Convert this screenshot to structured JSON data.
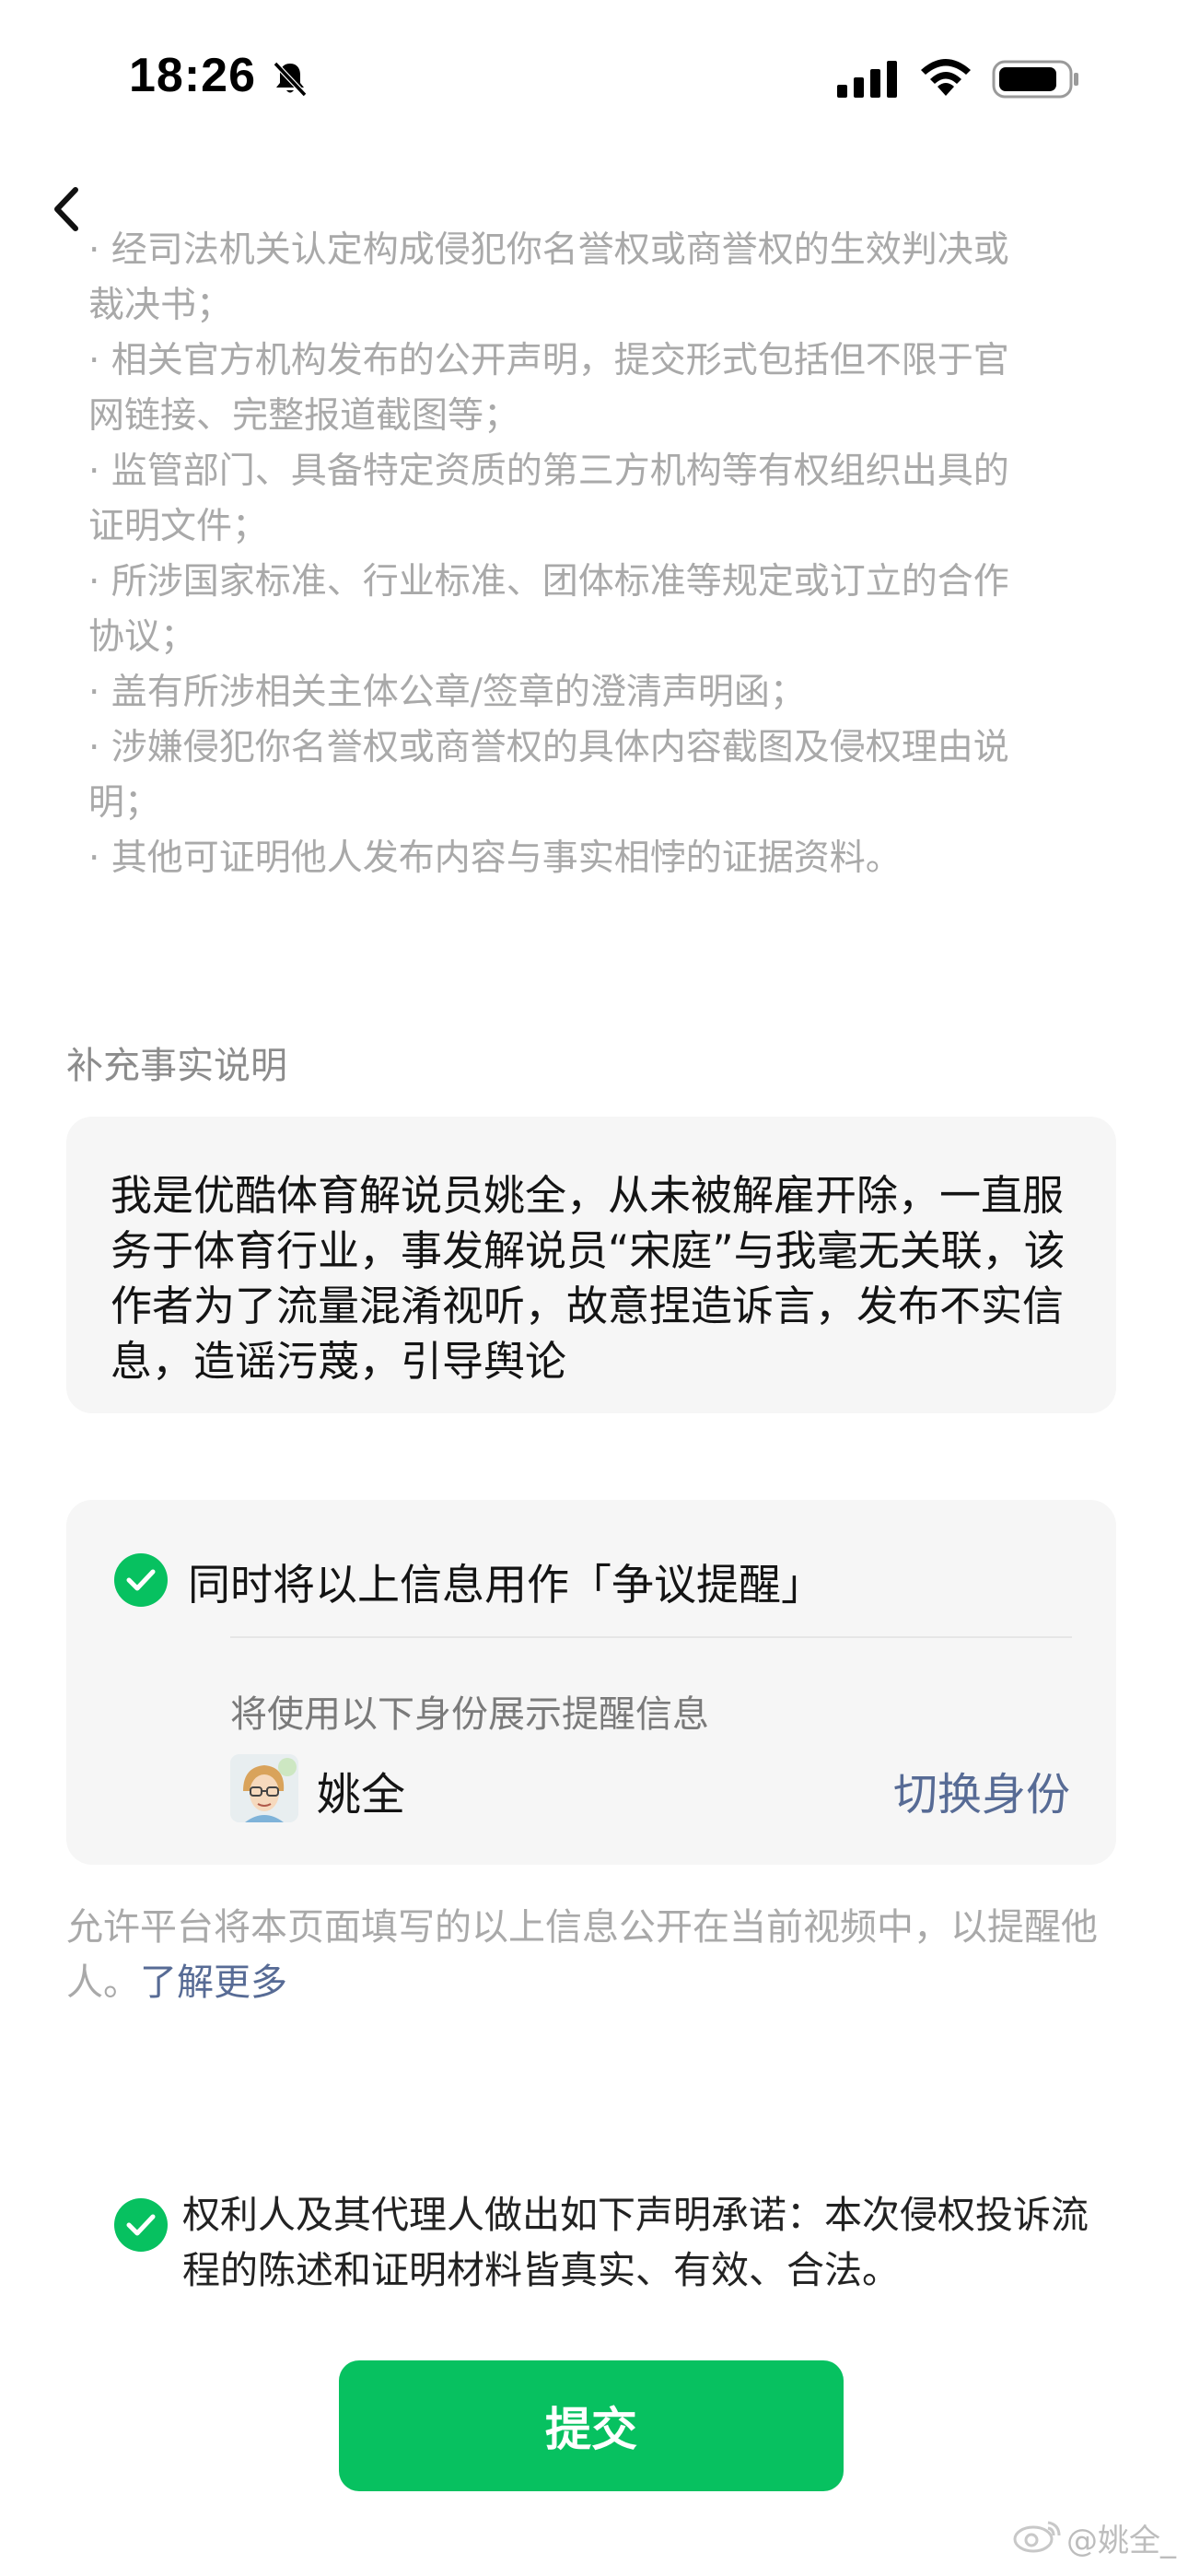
{
  "status_bar": {
    "time": "18:26",
    "icons": [
      "bell-slash-icon",
      "cellular-signal-icon",
      "wifi-icon",
      "battery-icon"
    ]
  },
  "nav": {
    "back_icon": "chevron-left-icon"
  },
  "evidence_list": {
    "lines": [
      "· 经司法机关认定构成侵犯你名誉权或商誉权的生效判决或",
      "裁决书；",
      "· 相关官方机构发布的公开声明，提交形式包括但不限于官",
      "网链接、完整报道截图等；",
      "· 监管部门、具备特定资质的第三方机构等有权组织出具的",
      "证明文件；",
      "· 所涉国家标准、行业标准、团体标准等规定或订立的合作",
      "协议；",
      "· 盖有所涉相关主体公章/签章的澄清声明函；",
      "· 涉嫌侵犯你名誉权或商誉权的具体内容截图及侵权理由说",
      "明；",
      "· 其他可证明他人发布内容与事实相悖的证据资料。"
    ]
  },
  "supplement": {
    "title": "补充事实说明",
    "text": "我是优酷体育解说员姚全，从未被解雇开除，一直服务于体育行业，事发解说员“宋庭”与我毫无关联，该作者为了流量混淆视听，故意捏造诉言，发布不实信息，造谣污蔑，引导舆论"
  },
  "dispute_reminder": {
    "checked": true,
    "label": "同时将以上信息用作「争议提醒」",
    "identity_caption": "将使用以下身份展示提醒信息",
    "identity_name": "姚全",
    "switch_label": "切换身份"
  },
  "notice": {
    "text": "允许平台将本页面填写的以上信息公开在当前视频中，以提醒他人。",
    "link": "了解更多"
  },
  "declaration": {
    "checked": true,
    "text": "权利人及其代理人做出如下声明承诺：本次侵权投诉流程的陈述和证明材料皆真实、有效、合法。"
  },
  "submit": {
    "label": "提交"
  },
  "watermark": {
    "text": "@姚全_"
  },
  "colors": {
    "accent_green": "#07c160",
    "link_blue": "#576b95",
    "muted_gray": "#a9a9a9",
    "card_bg": "#f6f6f6"
  }
}
